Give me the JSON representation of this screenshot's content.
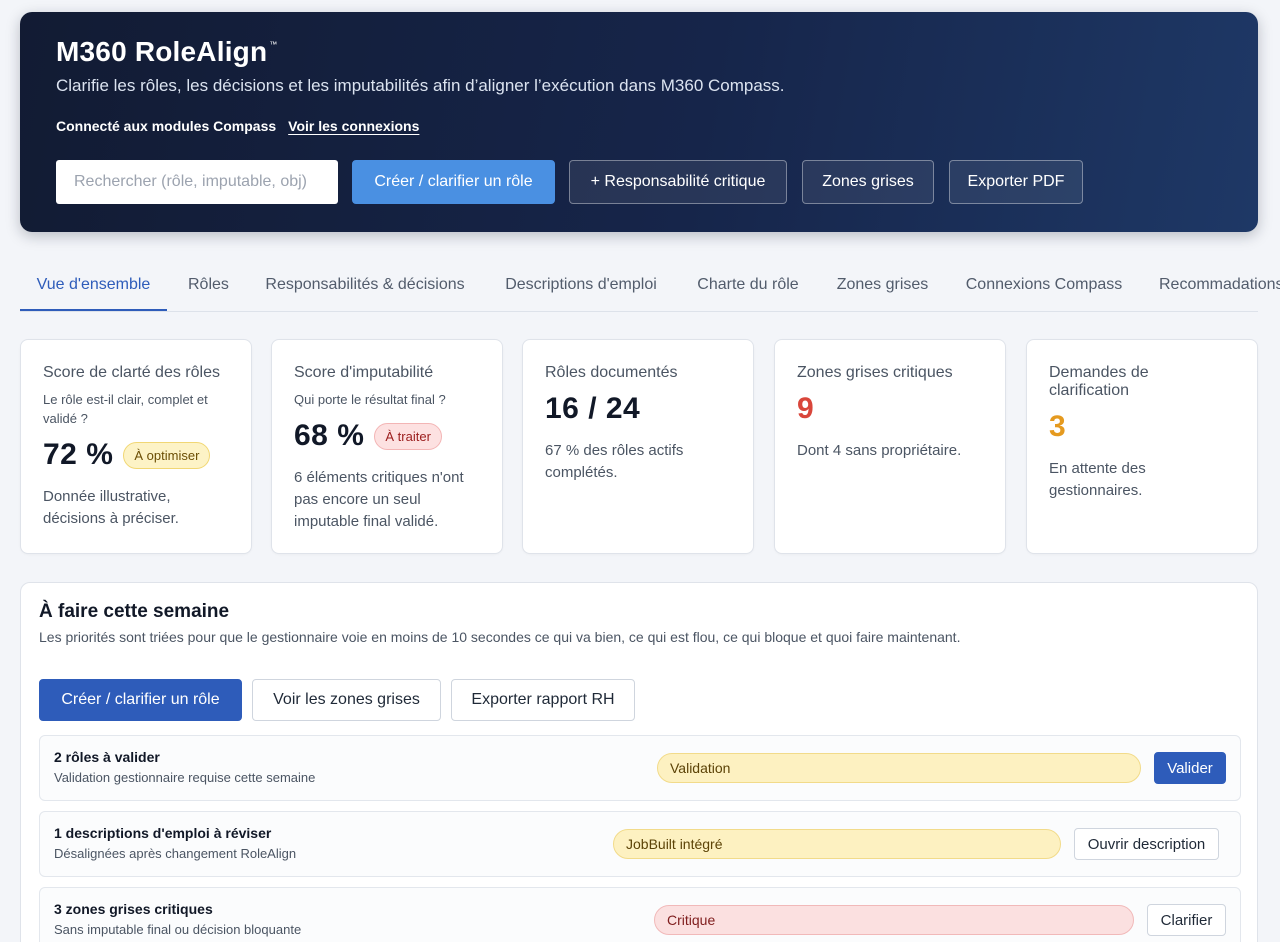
{
  "hero": {
    "title": "M360 RoleAlign",
    "trademark": "™",
    "subtitle": "Clarifie les rôles, les décisions et les imputabilités afin d’aligner l’exécution dans M360 Compass.",
    "connected_text": "Connecté aux modules Compass",
    "connections_link": "Voir les connexions",
    "search_placeholder": "Rechercher (rôle, imputable, obj)",
    "buttons": {
      "create": "Créer / clarifier un rôle",
      "critical": "+ Responsabilité critique",
      "grey_zones": "Zones grises",
      "export_pdf": "Exporter PDF"
    }
  },
  "tabs": [
    {
      "label": "Vue d'ensemble",
      "active": true
    },
    {
      "label": "Rôles"
    },
    {
      "label": "Responsabilités & décisions"
    },
    {
      "label": "Descriptions d'emploi"
    },
    {
      "label": "Charte du rôle"
    },
    {
      "label": "Zones grises"
    },
    {
      "label": "Connexions Compass"
    },
    {
      "label": "Recommadations"
    }
  ],
  "kpis": [
    {
      "title": "Score de clarté des rôles",
      "question": "Le rôle est-il clair, complet et validé ?",
      "value": "72 %",
      "badge": "À optimiser",
      "note": "Donnée illustrative, décisions à préciser."
    },
    {
      "title": "Score d'imputabilité",
      "question": "Qui porte le résultat final ?",
      "value": "68 %",
      "badge": "À traiter",
      "note": "6 éléments critiques n'ont pas encore un seul imputable final validé."
    },
    {
      "title": "Rôles documentés",
      "value": "16 / 24",
      "note": "67 % des rôles actifs complétés."
    },
    {
      "title": "Zones grises critiques",
      "value": "9",
      "value_color": "#d9463b",
      "note": "Dont 4 sans propriétaire."
    },
    {
      "title": "Demandes de clarification",
      "value": "3",
      "value_color": "#e59a1f",
      "note": "En attente des gestionnaires."
    }
  ],
  "week": {
    "title": "À faire cette semaine",
    "subtitle": "Les priorités sont triées pour que le gestionnaire voie en moins de 10 secondes ce qui va bien, ce qui est flou, ce qui bloque et quoi faire maintenant.",
    "buttons": {
      "create": "Créer / clarifier un rôle",
      "grey_zones": "Voir les zones grises",
      "export_hr": "Exporter rapport RH"
    },
    "tasks": [
      {
        "title": "2 rôles à valider",
        "desc": "Validation gestionnaire requise cette semaine",
        "tag": "Validation",
        "action": "Valider"
      },
      {
        "title": "1 descriptions d'emploi à réviser",
        "desc": "Désalignées après changement RoleAlign",
        "tag": "JobBuilt intégré",
        "action": "Ouvrir description"
      },
      {
        "title": "3 zones grises critiques",
        "desc": "Sans imputable final ou décision bloquante",
        "tag": "Critique",
        "action": "Clarifier"
      }
    ]
  }
}
